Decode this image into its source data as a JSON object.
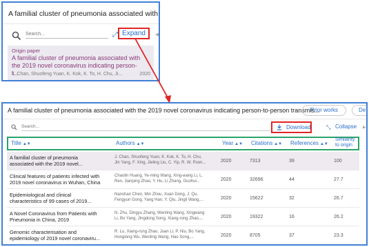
{
  "collapsed_panel": {
    "title": "A familial cluster of pneumonia associated with th",
    "search_placeholder": "Search...",
    "expand_label": "Expand",
    "origin_label": "Origin paper",
    "origin_title": "A familial cluster of pneumonia associated with the 2019 novel coronavirus indicating person-t...",
    "origin_authors": "J. Chan, Shuofeng Yuan, K. Kok, K. To, H. Chu, Ji...",
    "origin_year": "2020"
  },
  "expanded_panel": {
    "title": "A familial cluster of pneumonia associated with the 2019 novel coronavirus indicating person-to-person transmis...",
    "prior_works_label": "Prior works",
    "derivative_label": "De",
    "search_placeholder": "Search...",
    "download_label": "Download",
    "collapse_label": "Collapse",
    "columns": {
      "title": "Title",
      "authors": "Authors",
      "year": "Year",
      "citations": "Citations",
      "references": "References",
      "similarity_line1": "Similarity",
      "similarity_line2": "to origin"
    },
    "rows": [
      {
        "title_l1": "A familial cluster of pneumonia",
        "title_l2": "associated with the 2019 novel...",
        "authors_l1": "J. Chan, Shuofeng Yuan, K. Kok, K. To, H. Chu,",
        "authors_l2": "Jin Yang, F. Xing, Jieling Liu, C. Yip, R. W. Poon...",
        "year": "2020",
        "citations": "7313",
        "references": "39",
        "similarity": "100"
      },
      {
        "title_l1": "Clinical features of patients infected with",
        "title_l2": "2019 novel coronavirus in Wuhan, China",
        "authors_l1": "Chaolin Huang, Ye-ming Wang, Xing-wang Li, L.",
        "authors_l2": "Ren, Jianping Zhao, Y. Hu, Li Zhang, Guohui...",
        "year": "2020",
        "citations": "32696",
        "references": "44",
        "similarity": "27.7"
      },
      {
        "title_l1": "Epidemiological and clinical",
        "title_l2": "characteristics of 99 cases of 2019...",
        "authors_l1": "Nanshan Chen, Min Zhou, Xuan Dong, J. Qu,",
        "authors_l2": "Fengyun Gong, Yang Han, Y. Qiu, Jingli Wang,...",
        "year": "2020",
        "citations": "15622",
        "references": "32",
        "similarity": "26.7"
      },
      {
        "title_l1": "A Novel Coronavirus from Patients with",
        "title_l2": "Pneumonia in China, 2019",
        "authors_l1": "N. Zhu, Dingyu Zhang, Wenling Wang, Xingwang",
        "authors_l2": "Li, Bo Yang, Jingdong Song, Xiang-rong Zhao,...",
        "year": "2020",
        "citations": "19322",
        "references": "16",
        "similarity": "26.2"
      },
      {
        "title_l1": "Genomic characterisation and",
        "title_l2": "epidemiology of 2019 novel coronaviru...",
        "authors_l1": "R. Lu, Xiang-rong Zhao, Juan Li, P. Niu, Bo Yang,",
        "authors_l2": "Honglong Wu, Wenling Wang, Hao Song,...",
        "year": "2020",
        "citations": "8705",
        "references": "37",
        "similarity": "23.3"
      }
    ]
  },
  "colors": {
    "link_blue": "#2a6fc9",
    "panel_border": "#3f7fd6",
    "highlight_red": "#e02424",
    "header_green": "#2aa36a",
    "origin_purple": "#8a3a7a"
  }
}
